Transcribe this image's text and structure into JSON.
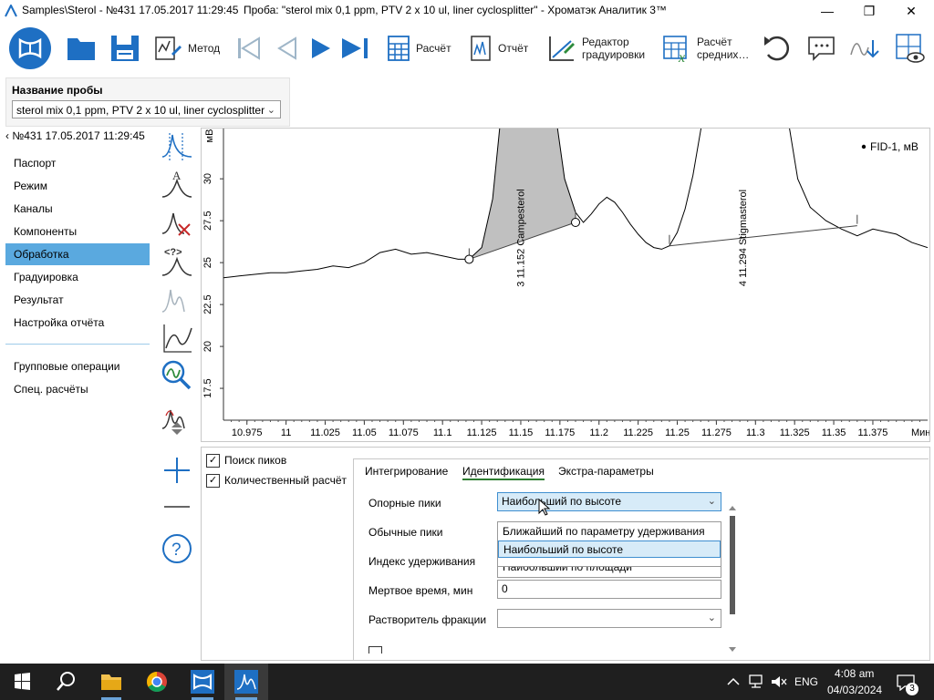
{
  "titlebar": {
    "path": "Samples\\Sterol - №431 17.05.2017 11:29:45",
    "sample": "Проба: \"sterol mix 0,1 ppm, PTV 2 x 10 ul, liner cyclosplitter\" - Хроматэк Аналитик 3™",
    "min_glyph": "—",
    "max_glyph": "❐",
    "close_glyph": "✕"
  },
  "toolbar": {
    "method_label": "Метод",
    "calc_label": "Расчёт",
    "report_label": "Отчёт",
    "calib_editor_label_1": "Редактор",
    "calib_editor_label_2": "градуировки",
    "calc_avg_label_1": "Расчёт",
    "calc_avg_label_2": "средних…"
  },
  "sample_panel": {
    "label": "Название пробы",
    "value": "sterol mix 0,1 ppm, PTV 2 x 10 ul, liner cyclosplitter"
  },
  "nav": {
    "back": "№431 17.05.2017 11:29:45",
    "items": [
      "Паспорт",
      "Режим",
      "Каналы",
      "Компоненты",
      "Обработка",
      "Градуировка",
      "Результат",
      "Настройка отчёта"
    ],
    "selected": "Обработка",
    "extra_items": [
      "Групповые операции",
      "Спец. расчёты"
    ]
  },
  "chart_data": {
    "type": "line",
    "ylabel": "мВ",
    "xlabel": "Мин",
    "legend": "FID-1, мВ",
    "legend_position": "top-right",
    "grid": false,
    "xlim": [
      10.96,
      11.41
    ],
    "ylim": [
      15.6,
      33
    ],
    "x_ticks": [
      "10.975",
      "11",
      "11.025",
      "11.05",
      "11.075",
      "11.1",
      "11.125",
      "11.15",
      "11.175",
      "11.2",
      "11.225",
      "11.25",
      "11.275",
      "11.3",
      "11.325",
      "11.35",
      "11.375"
    ],
    "y_ticks": [
      "17.5",
      "20",
      "22.5",
      "25",
      "27.5",
      "30"
    ],
    "series": [
      {
        "x": [
          10.96,
          10.97,
          10.98,
          10.99,
          11.0,
          11.01,
          11.02,
          11.03,
          11.04,
          11.05,
          11.06,
          11.07,
          11.08,
          11.09,
          11.1,
          11.11,
          11.117,
          11.125,
          11.132,
          11.137,
          11.142,
          11.148,
          11.152,
          11.158,
          11.165,
          11.172,
          11.178,
          11.185,
          11.19,
          11.195,
          11.2,
          11.205,
          11.21,
          11.215,
          11.22,
          11.225,
          11.23,
          11.235,
          11.24,
          11.245,
          11.25,
          11.255,
          11.26,
          11.267,
          11.272,
          11.28,
          11.287,
          11.294,
          11.3,
          11.307,
          11.315,
          11.32,
          11.327,
          11.335,
          11.345,
          11.355,
          11.365,
          11.375,
          11.39,
          11.4,
          11.41
        ],
        "y": [
          24.1,
          24.2,
          24.3,
          24.4,
          24.4,
          24.5,
          24.6,
          24.8,
          24.7,
          25.0,
          25.6,
          25.8,
          25.5,
          25.6,
          25.4,
          25.2,
          25.2,
          25.9,
          28.8,
          33.5,
          40,
          44,
          45,
          44,
          40,
          34,
          30,
          28.0,
          27.4,
          27.9,
          28.5,
          28.9,
          28.6,
          28.0,
          27.3,
          26.7,
          26.2,
          25.9,
          25.8,
          26.0,
          26.8,
          28.2,
          30.2,
          34,
          38,
          42,
          44,
          45,
          44,
          42,
          38,
          34,
          30,
          28.3,
          27.5,
          27.0,
          26.6,
          27.0,
          26.7,
          26.2,
          25.9
        ]
      }
    ],
    "peaks": [
      {
        "label": "3  11.152  Campesterol",
        "rt": 11.152
      },
      {
        "label": "4  11.294  Stigmasterol",
        "rt": 11.294
      }
    ],
    "baselines": [
      {
        "x": [
          11.117,
          11.185
        ],
        "y": [
          25.2,
          27.4
        ]
      },
      {
        "x": [
          11.245,
          11.365
        ],
        "y": [
          26.0,
          27.2
        ]
      }
    ]
  },
  "bottom": {
    "check_peaks_label": "Поиск пиков",
    "check_quant_label": "Количественный расчёт",
    "check_mark": "✓",
    "tabs": [
      "Интегрирование",
      "Идентификация",
      "Экстра-параметры"
    ],
    "active_tab": "Идентификация",
    "fields": {
      "ref_peaks_label": "Опорные пики",
      "ref_peaks_value": "Наибольший по высоте",
      "normal_peaks_label": "Обычные пики",
      "ret_index_label": "Индекс удерживания",
      "dead_time_label": "Мертвое время, мин",
      "dead_time_value": "0",
      "solvent_label": "Растворитель фракции",
      "solvent_value": ""
    },
    "dropdown_options": [
      "Ближайший по параметру удерживания",
      "Наибольший по высоте",
      "Наибольший по площади"
    ],
    "dropdown_selected": "Наибольший по высоте"
  },
  "taskbar": {
    "lang": "ENG",
    "time": "4:08 am",
    "date": "04/03/2024",
    "notifications": "3"
  },
  "colors": {
    "accent": "#1e6fc3",
    "nav_selected": "#5aa9df",
    "peak_fill": "#c0c0c0",
    "taskbar": "#1f1f1f"
  },
  "icons": [
    "app-logo-icon",
    "open-folder-icon",
    "save-icon",
    "method-icon",
    "first-icon",
    "prev-icon",
    "next-icon",
    "last-icon",
    "calculator-icon",
    "report-icon",
    "calibration-editor-icon",
    "average-calc-icon",
    "undo-icon",
    "comment-icon",
    "export-icon",
    "view-icon"
  ]
}
